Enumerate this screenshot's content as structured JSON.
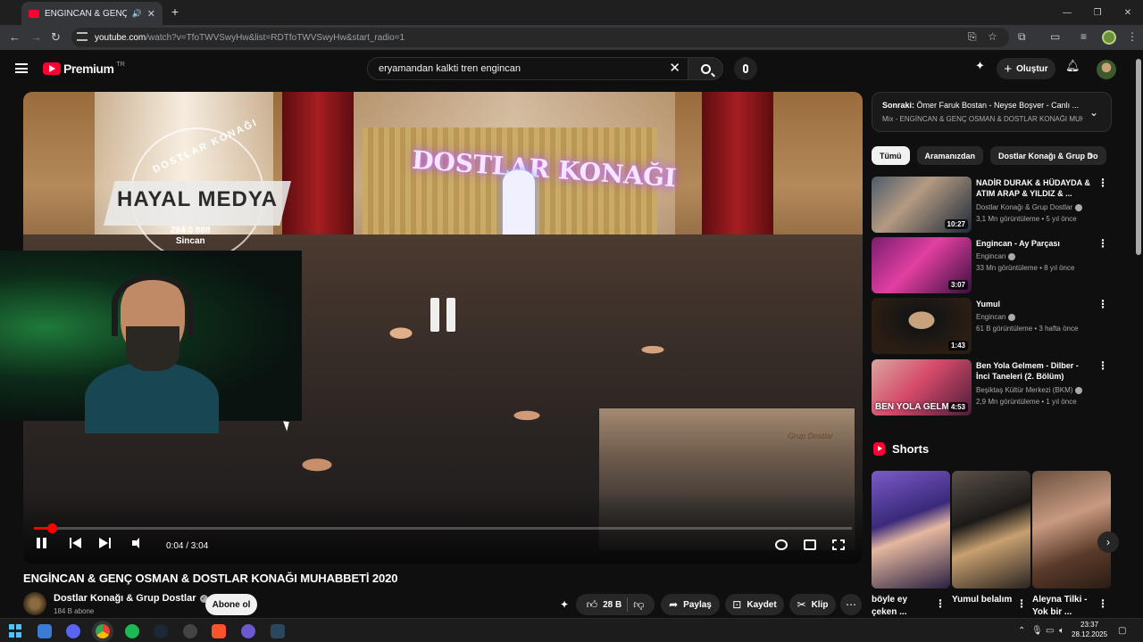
{
  "browser": {
    "tab_title": "ENGİNCAN & GENÇ OSMA",
    "url_host": "youtube.com",
    "url_rest": "/watch?v=TfoTWVSwyHw&list=RDTfoTWVSwyHw&start_radio=1"
  },
  "youtube": {
    "logo_text": "Premium",
    "logo_region": "TR",
    "search_value": "eryamandan kalkti tren engincan",
    "create_label": "Oluştur"
  },
  "player": {
    "watermark_brand": "HAYAL MEDYA",
    "watermark_top": "DOSTLAR KONAĞI",
    "watermark_phone": "264 0 888",
    "watermark_city": "Sincan",
    "stage_sign": "DOSTLAR KONAĞI",
    "inset_sign": "Grup Dostlar",
    "time_text": "0:04 / 3:04",
    "progress_fraction": 0.022
  },
  "video": {
    "title": "ENGİNCAN & GENÇ OSMAN & DOSTLAR KONAĞI MUHABBETİ 2020",
    "channel": "Dostlar Konağı & Grup Dostlar",
    "subscribers": "184 B abone",
    "subscribe_label": "Abone ol",
    "likes": "28 B",
    "share_label": "Paylaş",
    "save_label": "Kaydet",
    "clip_label": "Klip"
  },
  "sidebar": {
    "next_prefix": "Sonraki:",
    "next_title": "Ömer Faruk Bostan - Neyse Boşver - Canlı ...",
    "next_sub": "Mix - ENGİNCAN & GENÇ OSMAN & DOSTLAR KONAĞI MUH...",
    "chips": [
      "Tümü",
      "Aramanızdan",
      "Dostlar Konağı & Grup Do"
    ],
    "recommendations": [
      {
        "title": "NADİR DURAK & HÜDAYDA & ATIM ARAP & YILDIZ & ...",
        "channel": "Dostlar Konağı & Grup Dostlar",
        "meta": "3,1 Mn görüntüleme • 5 yıl önce",
        "duration": "10:27",
        "thumb_label": ""
      },
      {
        "title": "Engincan - Ay Parçası",
        "channel": "Engincan",
        "meta": "33 Mn görüntüleme • 8 yıl önce",
        "duration": "3:07",
        "thumb_label": ""
      },
      {
        "title": "Yumul",
        "channel": "Engincan",
        "meta": "61 B görüntüleme • 3 hafta önce",
        "duration": "1:43",
        "thumb_label": ""
      },
      {
        "title": "Ben Yola Gelmem - Dilber - İnci Taneleri (2. Bölüm)",
        "channel": "Beşiktaş Kültür Merkezi (BKM)",
        "meta": "2,9 Mn görüntüleme • 1 yıl önce",
        "duration": "4:53",
        "thumb_label": "BEN YOLA GELM"
      }
    ],
    "shorts_title": "Shorts",
    "shorts": [
      "böyle ey çeken ...",
      "Yumul belalım",
      "Aleyna Tilki - Yok bir ..."
    ]
  },
  "taskbar": {
    "time": "23:37",
    "date": "28.12.2025"
  }
}
